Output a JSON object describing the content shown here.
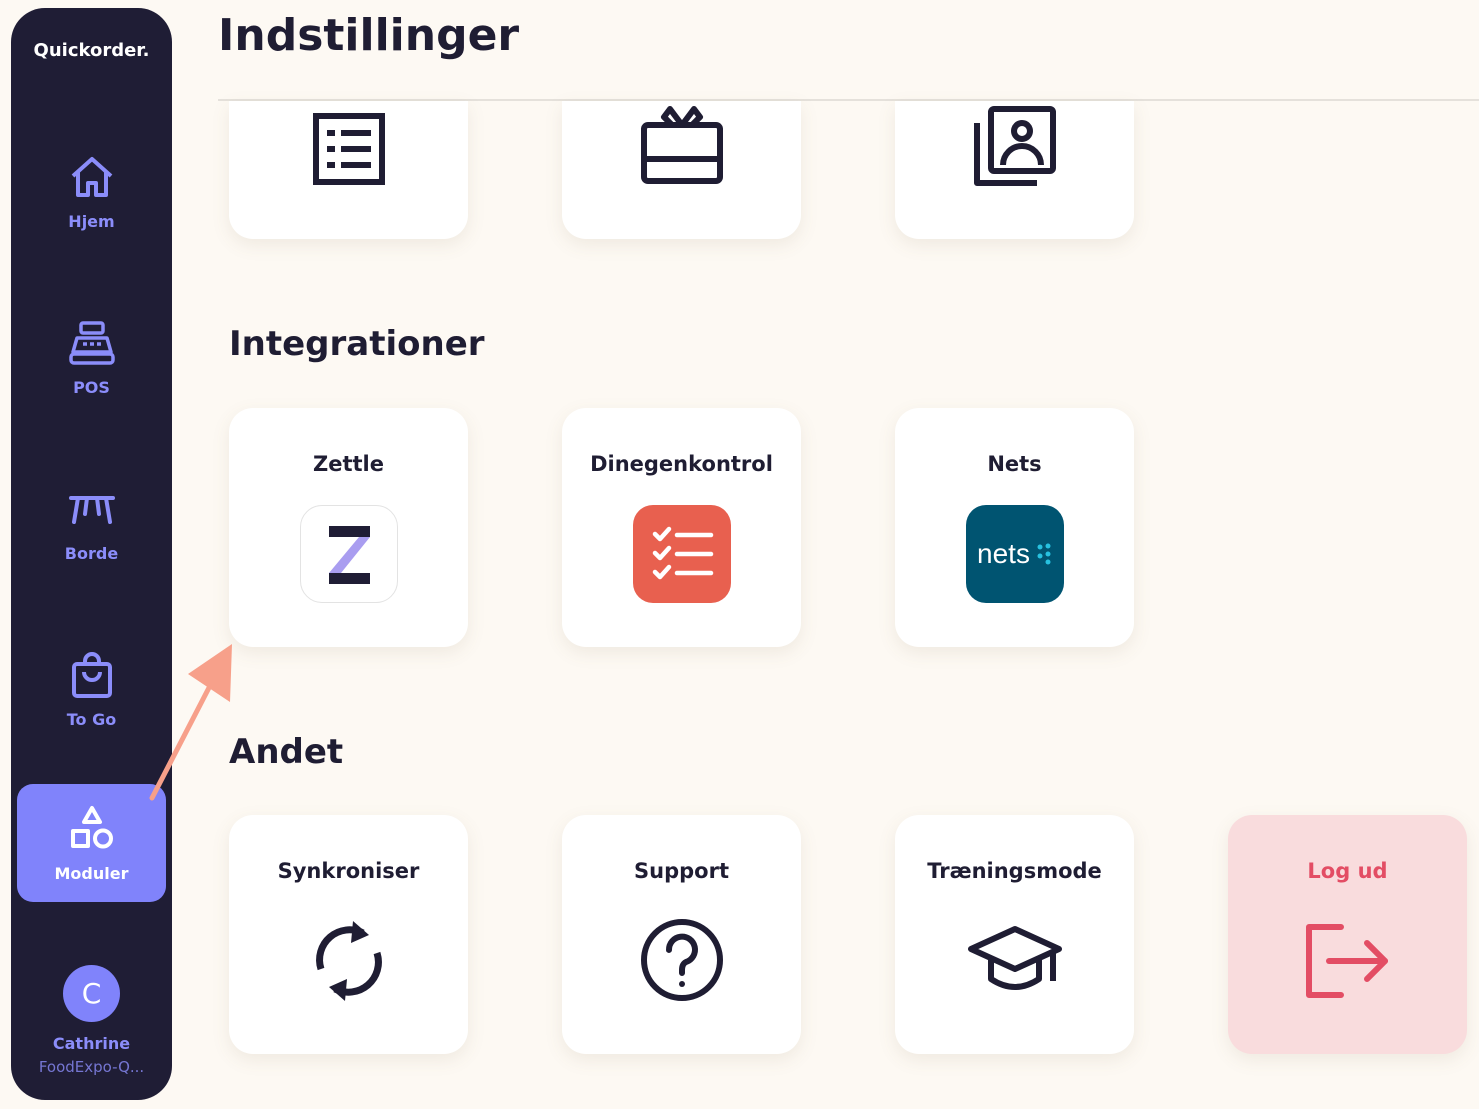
{
  "sidebar": {
    "brand": "Quickorder.",
    "items": [
      {
        "label": "Hjem",
        "icon": "home-icon"
      },
      {
        "label": "POS",
        "icon": "cash-register-icon"
      },
      {
        "label": "Borde",
        "icon": "table-icon"
      },
      {
        "label": "To Go",
        "icon": "shopping-bag-icon"
      },
      {
        "label": "Moduler",
        "icon": "shapes-icon",
        "active": true
      }
    ],
    "user": {
      "initial": "C",
      "name": "Cathrine",
      "org": "FoodExpo-Q..."
    }
  },
  "header": {
    "title": "Indstillinger"
  },
  "top_cards": [
    {
      "icon": "list-icon"
    },
    {
      "icon": "gift-card-icon"
    },
    {
      "icon": "photo-gallery-icon"
    }
  ],
  "sections": {
    "integrations": {
      "title": "Integrationer",
      "cards": [
        {
          "label": "Zettle",
          "icon": "zettle-logo",
          "logo_text": "Z"
        },
        {
          "label": "Dinegenkontrol",
          "icon": "checklist-logo"
        },
        {
          "label": "Nets",
          "icon": "nets-logo",
          "logo_text": "nets"
        }
      ]
    },
    "other": {
      "title": "Andet",
      "cards": [
        {
          "label": "Synkroniser",
          "icon": "sync-icon"
        },
        {
          "label": "Support",
          "icon": "help-icon"
        },
        {
          "label": "Træningsmode",
          "icon": "graduation-cap-icon"
        },
        {
          "label": "Log ud",
          "icon": "logout-icon"
        }
      ]
    }
  },
  "colors": {
    "sidebar_bg": "#1f1d35",
    "accent": "#8083fb",
    "page_bg": "#fdf9f3",
    "logout": "#e34d64",
    "dinegenkontrol": "#e8604f",
    "nets": "#005471",
    "annotation_arrow": "#f7a08a"
  }
}
